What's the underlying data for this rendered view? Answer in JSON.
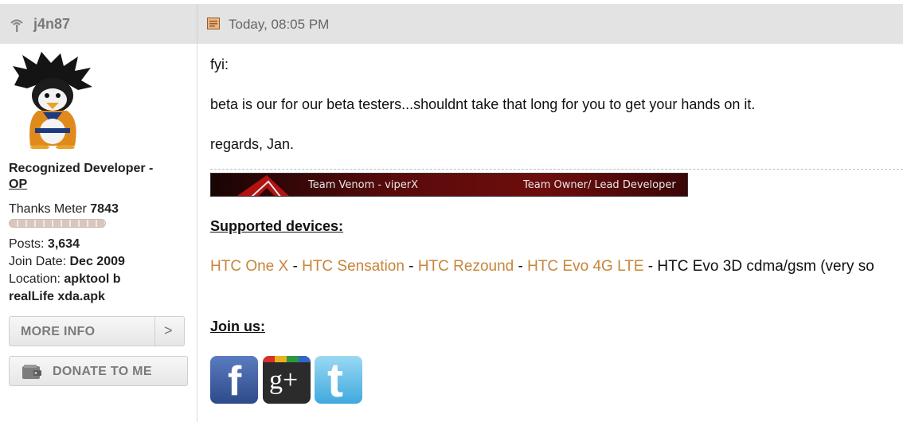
{
  "header": {
    "username": "j4n87",
    "post_date": "Today, 08:05 PM"
  },
  "user": {
    "title": "Recognized Developer -",
    "title_op": "OP",
    "thanks_label": "Thanks Meter",
    "thanks_value": "7843",
    "posts_label": "Posts:",
    "posts_value": "3,634",
    "join_label": "Join Date:",
    "join_value": "Dec 2009",
    "location_label": "Location:",
    "location_value_1": "apktool b",
    "location_value_2": "realLife xda.apk",
    "more_info_label": "MORE INFO",
    "more_info_arrow": ">",
    "donate_label": "DONATE TO ME"
  },
  "post": {
    "line1": "fyi:",
    "line2": "beta is our for our beta testers...shouldnt take that long for you to get your hands on it.",
    "line3": "regards, Jan.",
    "banner_left": "Team Venom - viperX",
    "banner_right": "Team Owner/ Lead Developer",
    "supported_heading": "Supported devices:",
    "devices": {
      "d1": "HTC One X",
      "d2": "HTC Sensation",
      "d3": "HTC Rezound",
      "d4": "HTC Evo 4G LTE",
      "d5": "HTC Evo 3D cdma/gsm (very so",
      "sep": " - "
    },
    "join_heading": "Join us:"
  },
  "social": {
    "facebook_glyph": "f",
    "googleplus_glyph": "g+",
    "twitter_glyph": "t"
  },
  "colors": {
    "link": "#c8853a",
    "header_bg": "#e3e3e3",
    "facebook": "#3b5998",
    "twitter": "#4fb7e8",
    "googleplus": "#2b2b2b"
  }
}
